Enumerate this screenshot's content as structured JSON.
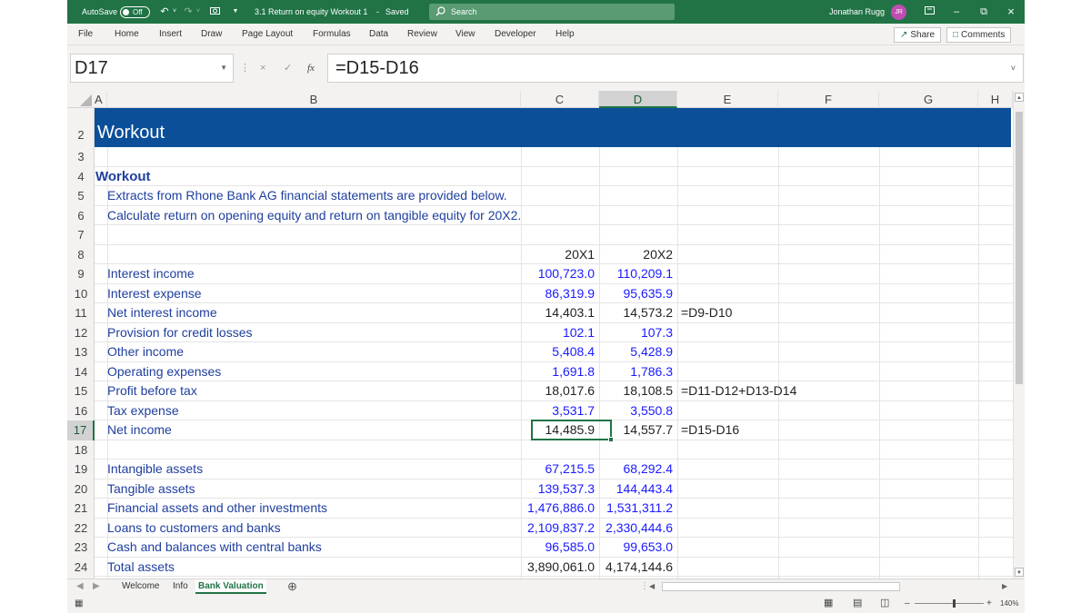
{
  "titlebar": {
    "autosave_label": "AutoSave",
    "autosave_state": "Off",
    "document_title": "3.1 Return on equity Workout 1",
    "save_status": "Saved",
    "search_placeholder": "Search",
    "user_name": "Jonathan Rugg",
    "user_initials": "JR"
  },
  "ribbon": {
    "tabs": [
      "File",
      "Home",
      "Insert",
      "Draw",
      "Page Layout",
      "Formulas",
      "Data",
      "Review",
      "View",
      "Developer",
      "Help"
    ],
    "share_label": "Share",
    "comments_label": "Comments"
  },
  "formula_bar": {
    "name_box": "D17",
    "fx_label": "fx",
    "formula": "=D15-D16"
  },
  "columns": [
    "A",
    "B",
    "C",
    "D",
    "E",
    "F",
    "G",
    "H"
  ],
  "rows": [
    "2",
    "3",
    "4",
    "5",
    "6",
    "7",
    "8",
    "9",
    "10",
    "11",
    "12",
    "13",
    "14",
    "15",
    "16",
    "17",
    "18",
    "19",
    "20",
    "21",
    "22",
    "23",
    "24"
  ],
  "sheet": {
    "banner_title": "Workout",
    "section_title": "Workout",
    "intro_1": "Extracts from Rhone Bank AG financial statements are provided below.",
    "intro_2": "Calculate return on opening equity and return on tangible equity for 20X2.",
    "year_1": "20X1",
    "year_2": "20X2",
    "lines": [
      {
        "label": "Interest income",
        "v1": "100,723.0",
        "v2": "110,209.1",
        "formula": ""
      },
      {
        "label": "Interest expense",
        "v1": "86,319.9",
        "v2": "95,635.9",
        "formula": ""
      },
      {
        "label": "Net interest income",
        "v1": "14,403.1",
        "v2": "14,573.2",
        "formula": "=D9-D10"
      },
      {
        "label": "Provision for credit losses",
        "v1": "102.1",
        "v2": "107.3",
        "formula": ""
      },
      {
        "label": "Other income",
        "v1": "5,408.4",
        "v2": "5,428.9",
        "formula": ""
      },
      {
        "label": "Operating expenses",
        "v1": "1,691.8",
        "v2": "1,786.3",
        "formula": ""
      },
      {
        "label": "Profit before tax",
        "v1": "18,017.6",
        "v2": "18,108.5",
        "formula": "=D11-D12+D13-D14"
      },
      {
        "label": "Tax expense",
        "v1": "3,531.7",
        "v2": "3,550.8",
        "formula": ""
      },
      {
        "label": "Net income",
        "v1": "14,485.9",
        "v2": "14,557.7",
        "formula": "=D15-D16"
      },
      {
        "label": "Intangible assets",
        "v1": "67,215.5",
        "v2": "68,292.4",
        "formula": ""
      },
      {
        "label": "Tangible assets",
        "v1": "139,537.3",
        "v2": "144,443.4",
        "formula": ""
      },
      {
        "label": "Financial assets and other investments",
        "v1": "1,476,886.0",
        "v2": "1,531,311.2",
        "formula": ""
      },
      {
        "label": "Loans to customers and banks",
        "v1": "2,109,837.2",
        "v2": "2,330,444.6",
        "formula": ""
      },
      {
        "label": "Cash and balances with central banks",
        "v1": "96,585.0",
        "v2": "99,653.0",
        "formula": ""
      },
      {
        "label": "Total assets",
        "v1": "3,890,061.0",
        "v2": "4,174,144.6",
        "formula": ""
      }
    ]
  },
  "sheet_tabs": [
    "Welcome",
    "Info",
    "Bank Valuation"
  ],
  "active_sheet": "Bank Valuation",
  "status": {
    "zoom": "140%"
  },
  "colors": {
    "excel_green": "#217346",
    "banner_blue": "#0b4f99",
    "input_blue": "#1a1aff",
    "label_navy": "#1f3f9e"
  }
}
